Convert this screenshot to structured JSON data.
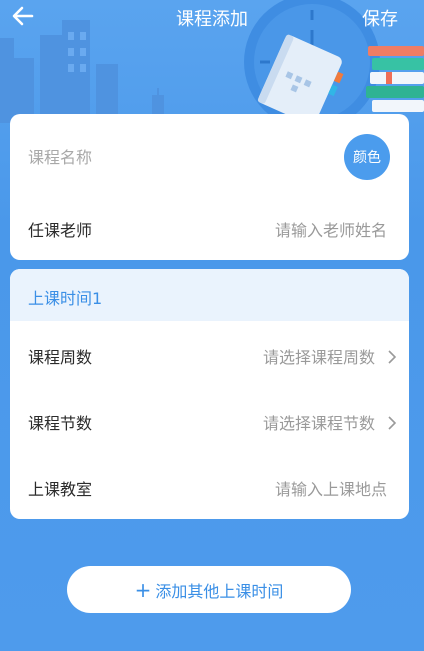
{
  "header": {
    "title": "课程添加",
    "save_label": "保存",
    "back_icon": "arrow-left-icon"
  },
  "course_card": {
    "course_name_placeholder": "课程名称",
    "color_button_label": "颜色",
    "teacher_label": "任课老师",
    "teacher_placeholder": "请输入老师姓名"
  },
  "time_section": {
    "title": "上课时间1",
    "weeks_label": "课程周数",
    "weeks_placeholder": "请选择课程周数",
    "periods_label": "课程节数",
    "periods_placeholder": "请选择课程节数",
    "room_label": "上课教室",
    "room_placeholder": "请输入上课地点"
  },
  "add_button": {
    "icon": "plus-icon",
    "label": "添加其他上课时间"
  },
  "colors": {
    "background": "#4e9bec",
    "accent": "#3a8fe6",
    "color_button": "#4b9ced",
    "section_header_bg": "#eaf3fd"
  }
}
